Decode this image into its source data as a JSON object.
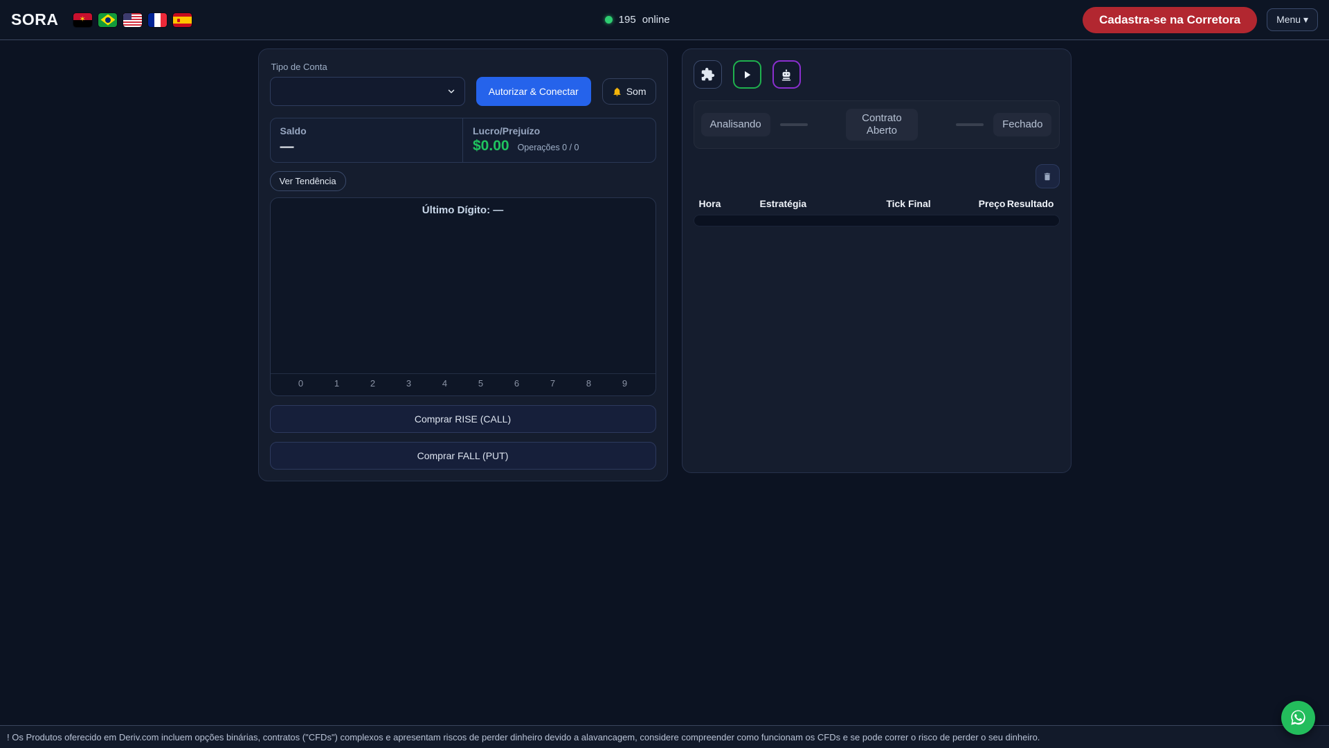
{
  "theme": {
    "page_bg": "#0c1322",
    "panel_bg": "#151d2e",
    "accent_blue": "#2563eb",
    "accent_red": "#b22730",
    "profit_green": "#1fc45f",
    "online_green": "#2ecc71",
    "play_border_green": "#1fb14e",
    "bot_border_purple": "#8b2fd0",
    "whatsapp_green": "#23bd5c"
  },
  "navbar": {
    "brand": "SORA",
    "flags": [
      {
        "name": "Angola"
      },
      {
        "name": "Brasil"
      },
      {
        "name": "Estados Unidos"
      },
      {
        "name": "França"
      },
      {
        "name": "Espanha"
      }
    ],
    "online_count": "195",
    "online_label": "online",
    "signup_label": "Cadastra-se na Corretora",
    "menu_label": "Menu ▾"
  },
  "left_panel": {
    "account_type_label": "Tipo de Conta",
    "account_type_value": "",
    "authorize_label": "Autorizar & Conectar",
    "sound_label": "Som",
    "balance_label": "Saldo",
    "balance_value": "—",
    "pnl_label": "Lucro/Prejuízo",
    "pnl_value": "$0.00",
    "operations_label": "Operações 0 / 0",
    "trend_label": "Ver Tendência",
    "chart": {
      "title": "Último Dígito: —",
      "digits": [
        "0",
        "1",
        "2",
        "3",
        "4",
        "5",
        "6",
        "7",
        "8",
        "9"
      ]
    },
    "rise_label": "Comprar RISE (CALL)",
    "fall_label": "Comprar FALL (PUT)"
  },
  "right_panel": {
    "tools": [
      {
        "name": "strategy-blocks"
      },
      {
        "name": "run-bot"
      },
      {
        "name": "bot"
      }
    ],
    "status_steps": [
      "Analisando",
      "Contrato Aberto",
      "Fechado"
    ],
    "table": {
      "headers": [
        "Hora",
        "Estratégia",
        "Tick Final",
        "Preço",
        "Resultado"
      ]
    }
  },
  "footer": {
    "disclaimer": "! Os Produtos oferecido em Deriv.com incluem opções binárias, contratos (\"CFDs\") complexos e apresentam riscos de perder dinheiro devido a alavancagem, considere compreender como funcionam os CFDs e se pode correr o risco de perder o seu dinheiro."
  }
}
